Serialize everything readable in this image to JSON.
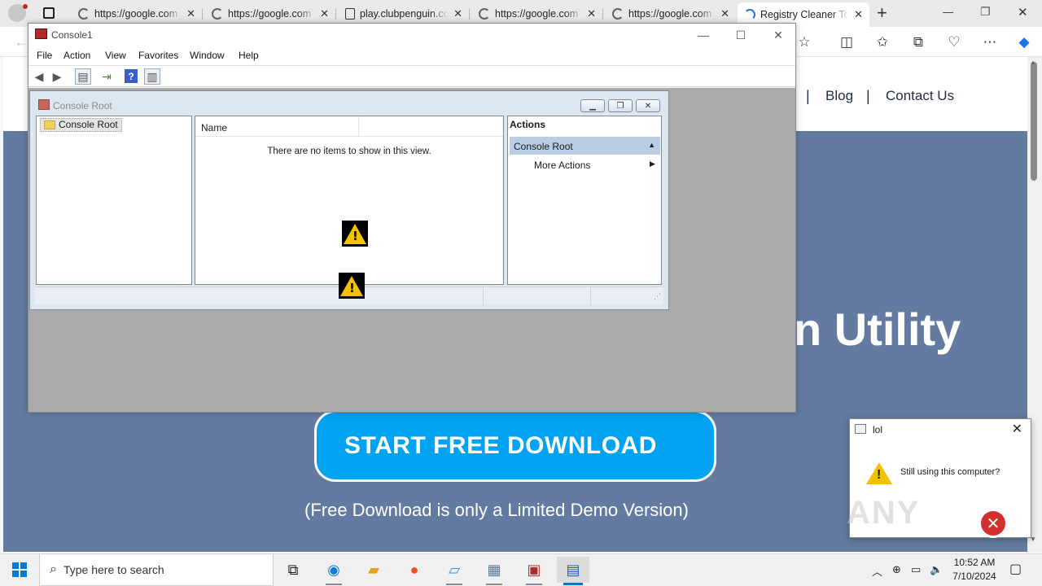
{
  "browser": {
    "tabs": [
      {
        "label": "https://google.com",
        "icon": "google-icon"
      },
      {
        "label": "https://google.com",
        "icon": "google-icon"
      },
      {
        "label": "play.clubpenguin.com",
        "icon": "page-icon"
      },
      {
        "label": "https://google.com",
        "icon": "google-icon"
      },
      {
        "label": "https://google.com",
        "icon": "google-icon"
      },
      {
        "label": "Registry Cleaner To",
        "icon": "loading-icon",
        "active": true
      }
    ],
    "new_tab_glyph": "+",
    "window_controls": {
      "minimize": "—",
      "restore": "❐",
      "close": "✕"
    }
  },
  "site": {
    "nav": {
      "blog": "Blog",
      "contact": "Contact Us",
      "separator": "|"
    },
    "hero_title_fragment": "n Utility",
    "download_button": "START FREE DOWNLOAD",
    "demo_note": "(Free Download is only a Limited Demo Version)",
    "colors": {
      "hero_bg": "#647ba1",
      "button_bg": "#00a2f2"
    }
  },
  "mmc": {
    "title": "Console1",
    "menu": [
      "File",
      "Action",
      "View",
      "Favorites",
      "Window",
      "Help"
    ],
    "child": {
      "title": "Console Root",
      "tree_item": "Console Root",
      "column_name": "Name",
      "empty_message": "There are no items to show in this view.",
      "actions_header": "Actions",
      "actions_group": "Console Root",
      "more_actions": "More Actions"
    }
  },
  "dialog": {
    "title": "lol",
    "message": "Still using this computer?",
    "close_glyph": "✕"
  },
  "watermark": "ANY",
  "taskbar": {
    "search_placeholder": "Type here to search",
    "time": "10:52 AM",
    "date": "7/10/2024"
  }
}
